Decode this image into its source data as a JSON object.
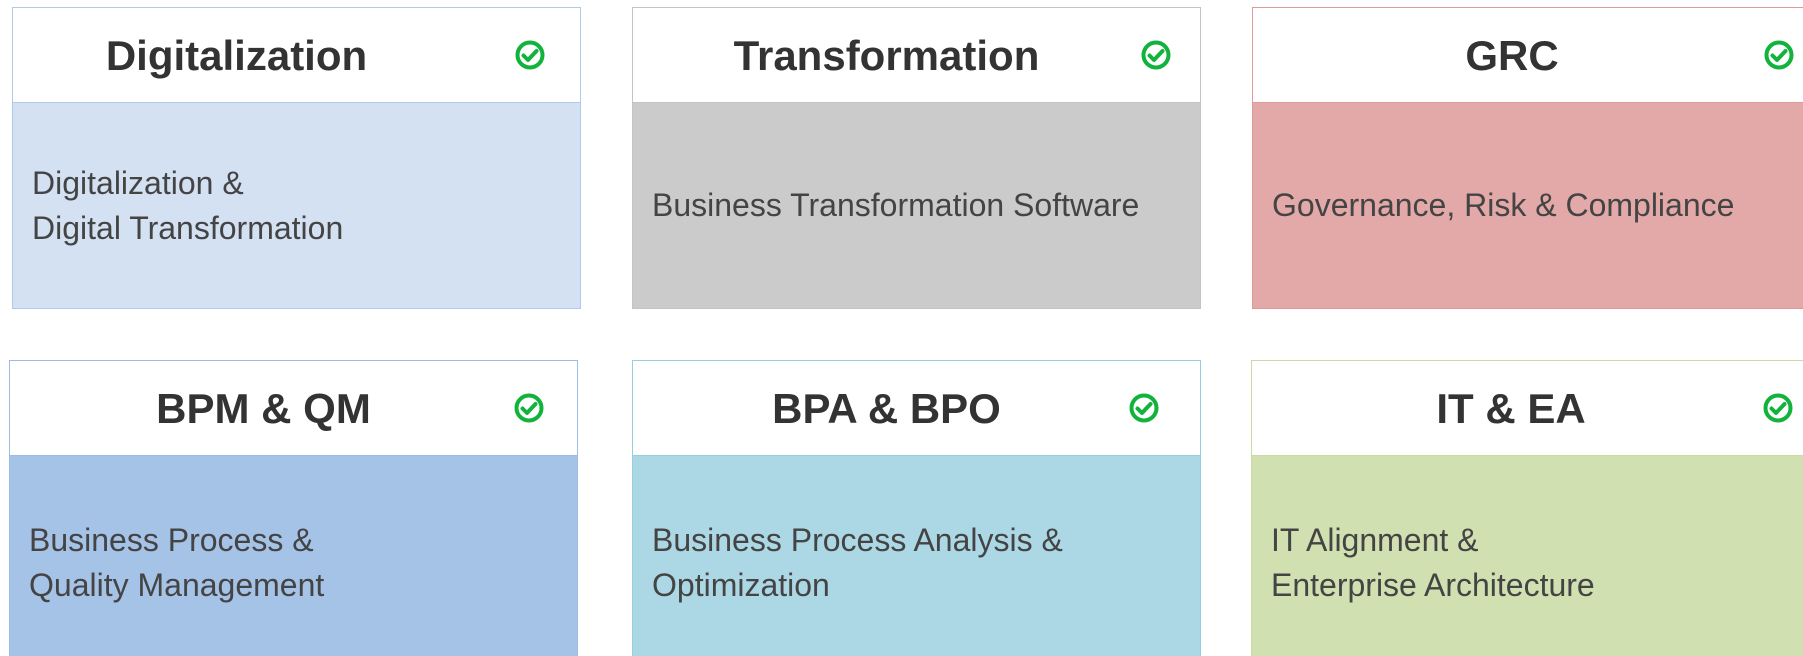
{
  "cards": [
    {
      "title": "Digitalization",
      "desc_lines": [
        "Digitalization &",
        "Digital Transformation"
      ],
      "body_color": "#d3e1f3",
      "border_color": "#aecbeb",
      "icon": "check-circle-icon"
    },
    {
      "title": "Transformation",
      "desc_lines": [
        "Business Transformation Software"
      ],
      "body_color": "#cbcbcb",
      "border_color": "#c4c4c4",
      "icon": "check-circle-icon"
    },
    {
      "title": "GRC",
      "desc_lines": [
        "Governance, Risk & Compliance"
      ],
      "body_color": "#e2a9a8",
      "border_color": "#dd9a98",
      "icon": "check-circle-icon"
    },
    {
      "title": "BPM & QM",
      "desc_lines": [
        "Business Process &",
        "Quality Management"
      ],
      "body_color": "#a5c2e7",
      "border_color": "#9dbbe3",
      "icon": "check-circle-icon"
    },
    {
      "title": "BPA & BPO",
      "desc_lines": [
        "Business Process Analysis &",
        "Optimization"
      ],
      "body_color": "#acd8e5",
      "border_color": "#97cfe0",
      "icon": "check-circle-icon"
    },
    {
      "title": "IT & EA",
      "desc_lines": [
        "IT Alignment &",
        "Enterprise Architecture"
      ],
      "body_color": "#d1e0b1",
      "border_color": "#c9dba5",
      "icon": "check-circle-icon"
    }
  ],
  "colors": {
    "check_green": "#12b33c"
  }
}
